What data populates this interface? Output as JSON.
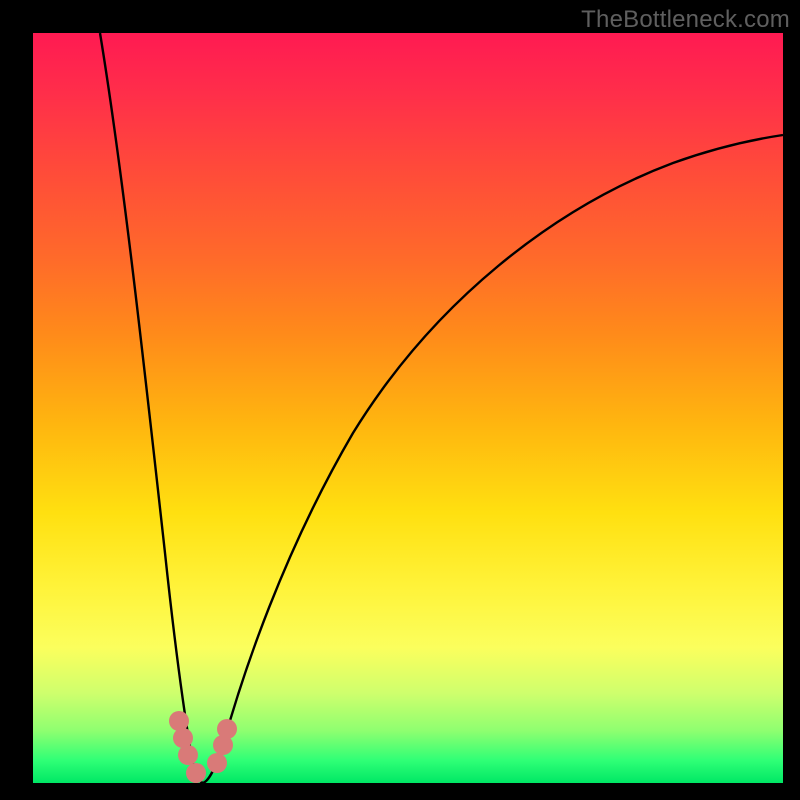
{
  "watermark": "TheBottleneck.com",
  "chart_data": {
    "type": "line",
    "title": "",
    "xlabel": "",
    "ylabel": "",
    "xlim": [
      0,
      100
    ],
    "ylim": [
      0,
      100
    ],
    "grid": false,
    "legend": false,
    "notes": "Bottleneck-style V curve. Background gradient encodes distance-from-zero (red=high bottleneck, green=near-zero). Two black curves descend to a minimum near x≈20 and diverge; right curve rises slowly toward the top-right. Pink rounded markers sit on the curves near the bottom.",
    "series": [
      {
        "name": "left-curve",
        "x": [
          9,
          10,
          11,
          12,
          13,
          14,
          15,
          16,
          17,
          18,
          19,
          20,
          21
        ],
        "y": [
          100,
          88,
          77,
          66,
          55,
          45,
          35,
          26,
          18,
          11,
          5,
          1,
          0
        ]
      },
      {
        "name": "right-curve",
        "x": [
          21,
          23,
          26,
          30,
          35,
          40,
          47,
          55,
          63,
          72,
          82,
          92,
          100
        ],
        "y": [
          0,
          3,
          10,
          20,
          32,
          42,
          52,
          61,
          68,
          74,
          79,
          83,
          86
        ]
      }
    ],
    "markers": [
      {
        "series": "left-curve",
        "x": 18.5,
        "y": 8
      },
      {
        "series": "left-curve",
        "x": 19.0,
        "y": 5
      },
      {
        "series": "left-curve",
        "x": 19.7,
        "y": 2
      },
      {
        "series": "left-curve",
        "x": 20.5,
        "y": 0.5
      },
      {
        "series": "right-curve",
        "x": 22.5,
        "y": 2
      },
      {
        "series": "right-curve",
        "x": 23.2,
        "y": 5
      },
      {
        "series": "right-curve",
        "x": 23.7,
        "y": 7
      }
    ],
    "colors": {
      "curve": "#000000",
      "marker_fill": "#d97a78",
      "gradient_top": "#ff1a52",
      "gradient_bottom": "#00e765"
    }
  }
}
